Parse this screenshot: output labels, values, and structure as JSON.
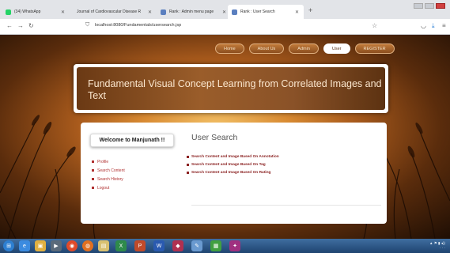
{
  "browser": {
    "tabs": [
      {
        "label": "(34) WhatsApp",
        "active": false,
        "icon": "whatsapp-icon",
        "color": "#25d366"
      },
      {
        "label": "Journal of Cardiovascular Disease R",
        "active": false,
        "icon": "page-icon",
        "color": "#9aa4b0"
      },
      {
        "label": "Rank : Admin menu page",
        "active": false,
        "icon": "page-icon",
        "color": "#5a7fbf"
      },
      {
        "label": "Rank : User Search",
        "active": true,
        "icon": "page-icon",
        "color": "#5a7fbf"
      }
    ],
    "url": "localhost:8080/Fundamentals/usersearch.jsp"
  },
  "nav": {
    "items": [
      "Home",
      "About Us",
      "Admin",
      "User",
      "REGISTER"
    ],
    "active": "User"
  },
  "banner": {
    "title": "Fundamental Visual Concept Learning from Correlated Images and Text"
  },
  "sidebar": {
    "welcome": "Welcome to Manjunath !!",
    "links": [
      "Profile",
      "Search Content",
      "Search History",
      "Logout"
    ]
  },
  "main": {
    "heading": "User Search",
    "actions": [
      "Search Content and Image Based On Annotation",
      "Search Content and Image Based On Tag",
      "Search Content and Image Based On Rating"
    ]
  },
  "colors": {
    "accent": "#b03030",
    "banner_text": "#fbe7cf"
  }
}
